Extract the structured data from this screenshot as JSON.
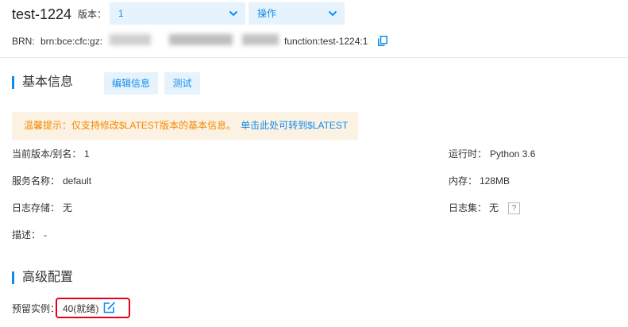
{
  "header": {
    "function_name": "test-1224",
    "version_label": "版本：",
    "version_value": "1",
    "operation_label": "操作",
    "brn_label": "BRN:",
    "brn_prefix": "brn:bce:cfc:gz:",
    "brn_suffix": "function:test-1224:1"
  },
  "basic": {
    "title": "基本信息",
    "edit_button": "编辑信息",
    "test_button": "测试",
    "notice_text": "温馨提示：仅支持修改$LATEST版本的基本信息。",
    "notice_link": "单击此处可转到$LATEST",
    "fields": {
      "version_alias_label": "当前版本/别名：",
      "version_alias_value": "1",
      "service_label": "服务名称：",
      "service_value": "default",
      "log_storage_label": "日志存储：",
      "log_storage_value": "无",
      "desc_label": "描述：",
      "desc_value": "-",
      "runtime_label": "运行时：",
      "runtime_value": "Python 3.6",
      "memory_label": "内存：",
      "memory_value": "128MB",
      "logset_label": "日志集：",
      "logset_value": "无",
      "help_glyph": "?"
    }
  },
  "advanced": {
    "title": "高级配置",
    "reserved_label": "预留实例：",
    "reserved_value": "40(就绪)"
  },
  "colors": {
    "accent": "#108cee",
    "accent_bg": "#e6f3fd",
    "warning": "#f38900",
    "warning_bg": "#fcf2e3",
    "highlight_border": "#e6001a"
  },
  "icons": [
    "chevron-down-icon",
    "copy-icon",
    "help-icon",
    "edit-icon"
  ]
}
